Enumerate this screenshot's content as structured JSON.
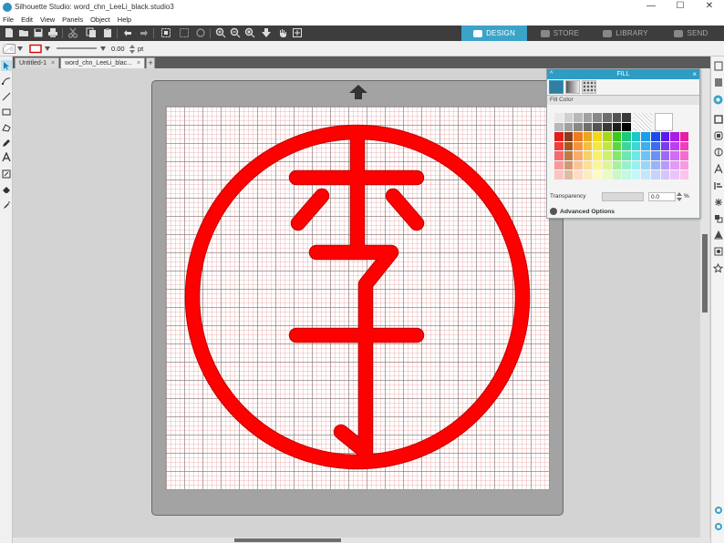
{
  "window": {
    "title": "Silhouette Studio: word_chn_LeeLi_black.studio3",
    "controls": [
      "—",
      "☐",
      "✕"
    ]
  },
  "menu": [
    "File",
    "Edit",
    "View",
    "Panels",
    "Object",
    "Help"
  ],
  "nav_tabs": [
    {
      "label": "DESIGN",
      "active": true
    },
    {
      "label": "STORE",
      "active": false
    },
    {
      "label": "LIBRARY",
      "active": false
    },
    {
      "label": "SEND",
      "active": false
    }
  ],
  "property_bar": {
    "stroke_width": "0.00",
    "stroke_unit": "pt"
  },
  "doc_tabs": [
    {
      "label": "Untitled-1",
      "active": false
    },
    {
      "label": "word_chn_LeeLi_blac...",
      "active": true
    }
  ],
  "doc_tab_close": "×",
  "doc_tab_add": "+",
  "fill_panel": {
    "title": "FILL",
    "section": "Fill Color",
    "transparency_label": "Transparency",
    "transparency_value": "0.0",
    "transparency_unit": "%",
    "advanced_label": "Advanced Options",
    "grays": [
      "#ffffff",
      "#e8e8e8",
      "#d0d0d0",
      "#b8b8b8",
      "#a0a0a0",
      "#888888",
      "#6e6e6e",
      "#545454",
      "#3a3a3a",
      "#1e1e1e",
      "#000000"
    ],
    "palette_rows": [
      [
        "#e31c1c",
        "#8b3b19",
        "#f07a1c",
        "#e8a81c",
        "#f0d81c",
        "#a8d81c",
        "#3cc81c",
        "#1cc87a",
        "#1cc8c8",
        "#1c9ce8",
        "#1c4ce8",
        "#5a1ce8",
        "#a81ce8",
        "#e81ca8"
      ],
      [
        "#f03c3c",
        "#a8581c",
        "#f5943c",
        "#f0c03c",
        "#f5e83c",
        "#c0e83c",
        "#5ad83c",
        "#3cd89a",
        "#3cd8d8",
        "#3cb0f0",
        "#3c6cf0",
        "#7a3cf0",
        "#c03cf0",
        "#f03cc0"
      ],
      [
        "#f56c6c",
        "#c07a46",
        "#f8ac6c",
        "#f5d06c",
        "#f8f06c",
        "#d0f06c",
        "#84e86c",
        "#6ce8b4",
        "#6ce8e8",
        "#6cc4f5",
        "#6c90f5",
        "#9a6cf5",
        "#d06cf5",
        "#f56cd0"
      ],
      [
        "#f89a9a",
        "#d09a70",
        "#fac49a",
        "#f8e09a",
        "#fbf59a",
        "#e0f59a",
        "#aaf09a",
        "#9af0cc",
        "#9af0f0",
        "#9ad6f8",
        "#9ab2f8",
        "#b89af8",
        "#e09af8",
        "#f89ae0"
      ],
      [
        "#fbc4c4",
        "#e0bca0",
        "#fcdcc4",
        "#fbecc4",
        "#fdfac4",
        "#ecfac4",
        "#ccf8c4",
        "#c4f8e2",
        "#c4f8f8",
        "#c4e8fb",
        "#c4d4fb",
        "#d6c4fb",
        "#ecc4fb",
        "#fbc4ec"
      ]
    ]
  },
  "design": {
    "color": "#ff0000",
    "outline": "#c00000"
  }
}
